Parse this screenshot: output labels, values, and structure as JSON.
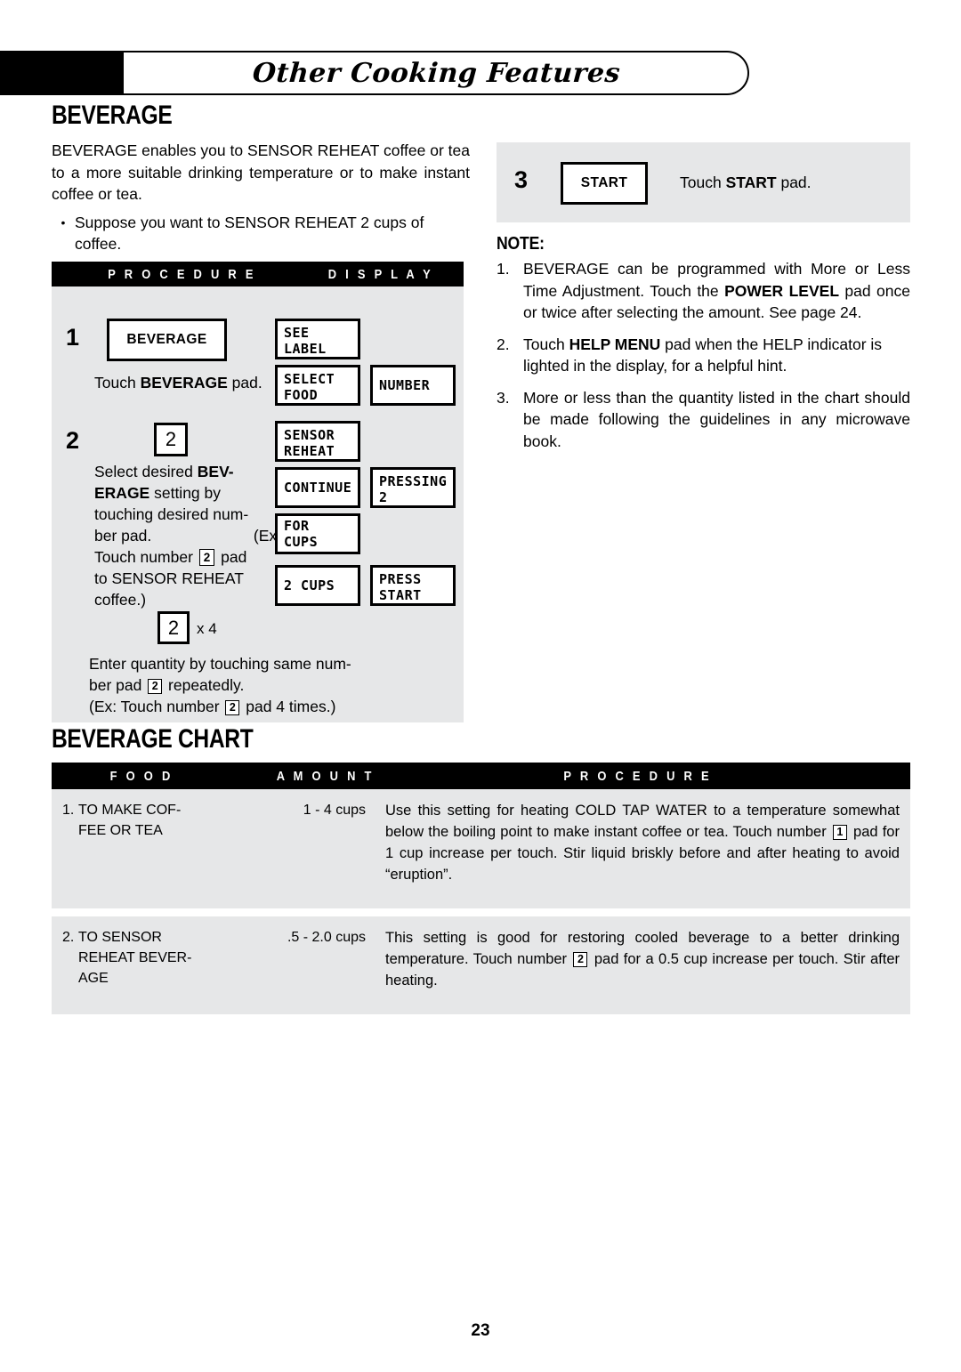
{
  "header": {
    "title": "Other Cooking Features"
  },
  "page_number": "23",
  "beverage": {
    "heading": "BEVERAGE",
    "intro": "BEVERAGE enables you to SENSOR REHEAT coffee or tea to a more suitable drinking temperature or to make instant coffee or tea.",
    "bullet_marker": "•",
    "bullet": "Suppose you want to SENSOR REHEAT 2 cups of coffee."
  },
  "procedure_table": {
    "headers": {
      "procedure": "P R O C E D U R E",
      "display": "D I S P L A Y"
    },
    "steps": [
      {
        "number": "1",
        "pad_label": "BEVERAGE",
        "text_prefix": "Touch ",
        "text_bold": "BEVERAGE",
        "text_suffix": " pad.",
        "displays": [
          {
            "line1": "SEE",
            "line2": "LABEL"
          },
          {
            "line1": "SELECT",
            "line2": "FOOD"
          },
          {
            "line1": "NUMBER",
            "line2": ""
          }
        ]
      },
      {
        "number": "2",
        "pad_label": "2",
        "text_line1_a": "Select desired ",
        "text_line1_b": "BEV-",
        "text_line2_a": "ERAGE",
        "text_line2_b": " setting by",
        "text_line3": "touching desired num-",
        "text_line4_a": "ber pad.",
        "text_line4_b": "(Ex:",
        "text_line5_a": "Touch number ",
        "text_line5_key": "2",
        "text_line5_b": " pad",
        "text_line6": "to SENSOR REHEAT",
        "text_line7": "coffee.)",
        "repeat_key": "2",
        "repeat_times": "x 4",
        "repeat_line1": "Enter quantity by touching same num-",
        "repeat_line2_a": "ber pad ",
        "repeat_line2_key": "2",
        "repeat_line2_b": " repeatedly.",
        "repeat_line3_a": "(Ex: Touch number ",
        "repeat_line3_key": "2",
        "repeat_line3_b": " pad 4 times.)",
        "displays": [
          {
            "line1": "SENSOR",
            "line2": "REHEAT"
          },
          {
            "line1": "CONTINUE",
            "line2": ""
          },
          {
            "line1": "PRESSING",
            "line2": "2"
          },
          {
            "line1": "FOR CUPS",
            "line2": ""
          },
          {
            "line1": "2 CUPS",
            "line2": ""
          },
          {
            "line1": "PRESS",
            "line2": "START"
          }
        ]
      }
    ]
  },
  "step3": {
    "number": "3",
    "pad_label": "START",
    "text_prefix": "Touch ",
    "text_bold": "START",
    "text_suffix": " pad."
  },
  "note": {
    "heading": "NOTE:",
    "items": [
      {
        "number": "1.",
        "part_a": "BEVERAGE can be programmed with More or Less Time Adjustment. Touch the ",
        "bold": "POWER LEVEL",
        "part_b": " pad once or twice after selecting the amount. See page 24."
      },
      {
        "number": "2.",
        "part_a": "Touch ",
        "bold": "HELP MENU",
        "part_b": " pad when the HELP indicator is lighted in the display, for a helpful hint."
      },
      {
        "number": "3.",
        "part_a": "More or less than the quantity listed in the chart should be made following the guidelines in any microwave book.",
        "bold": "",
        "part_b": ""
      }
    ]
  },
  "beverage_chart": {
    "heading": "BEVERAGE CHART",
    "headers": {
      "food": "F O O D",
      "amount": "A M O U N T",
      "procedure": "P R O C E D U R E"
    },
    "rows": [
      {
        "num": "1.",
        "food_line1": "TO MAKE COF-",
        "food_line2": "FEE OR TEA",
        "food_line3": "",
        "amount": "1  - 4 cups",
        "proc_a": "Use this setting for heating COLD TAP WATER to a temperature somewhat below the boiling point to make instant coffee or tea. Touch number ",
        "proc_key": "1",
        "proc_b": " pad for 1 cup increase per touch. Stir liquid briskly before and after heating to avoid “eruption”."
      },
      {
        "num": "2.",
        "food_line1": "TO SENSOR",
        "food_line2": "REHEAT BEVER-",
        "food_line3": "AGE",
        "amount": ".5  - 2.0 cups",
        "proc_a": "This setting is good for restoring cooled beverage to a better drinking temperature. Touch number ",
        "proc_key": "2",
        "proc_b": " pad for a 0.5 cup increase per touch. Stir after heating."
      }
    ]
  }
}
